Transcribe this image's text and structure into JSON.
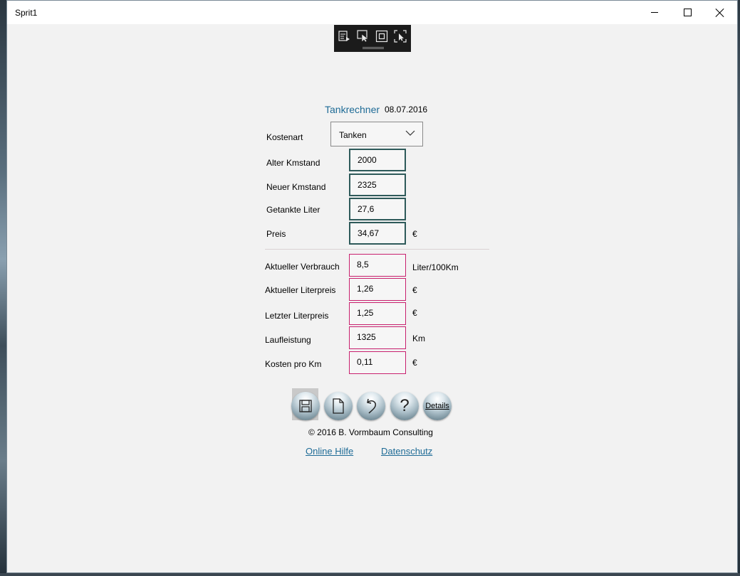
{
  "window": {
    "title": "Sprit1"
  },
  "header": {
    "title": "Tankrechner",
    "date": "08.07.2016"
  },
  "form": {
    "kostenart": {
      "label": "Kostenart",
      "value": "Tanken"
    },
    "alter_km": {
      "label": "Alter Kmstand",
      "value": "2000"
    },
    "neuer_km": {
      "label": "Neuer Kmstand",
      "value": "2325"
    },
    "liter": {
      "label": "Getankte Liter",
      "value": "27,6"
    },
    "preis": {
      "label": "Preis",
      "value": "34,67",
      "unit": "€"
    }
  },
  "results": {
    "verbrauch": {
      "label": "Aktueller Verbrauch",
      "value": "8,5",
      "unit": "Liter/100Km"
    },
    "literpreis": {
      "label": "Aktueller Literpreis",
      "value": "1,26",
      "unit": "€"
    },
    "letzter_literpreis": {
      "label": "Letzter Literpreis",
      "value": "1,25",
      "unit": "€"
    },
    "laufleistung": {
      "label": "Laufleistung",
      "value": "1325",
      "unit": "Km"
    },
    "kosten_pro_km": {
      "label": "Kosten pro Km",
      "value": "0,11",
      "unit": "€"
    }
  },
  "toolbar": {
    "save_icon": "floppy-disk-icon",
    "new_icon": "new-document-icon",
    "undo_icon": "undo-icon",
    "help_label": "?",
    "details_label": "Details"
  },
  "footer": {
    "copyright": "© 2016 B. Vormbaum Consulting",
    "help_link": "Online Hilfe",
    "privacy_link": "Datenschutz"
  },
  "colors": {
    "accent": "#1e6b96",
    "input_border": "#2e5a5a",
    "result_border": "#c8206e"
  }
}
